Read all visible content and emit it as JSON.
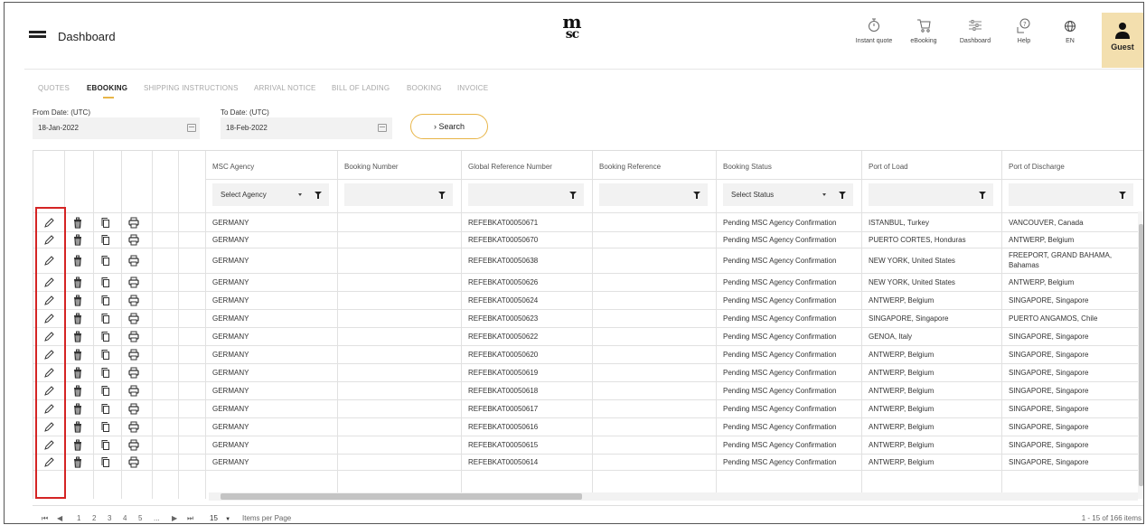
{
  "header": {
    "title": "Dashboard",
    "logo_top": "m",
    "logo_bottom": "sc",
    "nav": [
      {
        "label": "Instant quote",
        "icon": "stopwatch-icon"
      },
      {
        "label": "eBooking",
        "icon": "cart-icon"
      },
      {
        "label": "Dashboard",
        "icon": "sliders-icon"
      },
      {
        "label": "Help",
        "icon": "help-icon"
      },
      {
        "label": "EN",
        "icon": "globe-icon"
      }
    ],
    "guest_label": "Guest"
  },
  "tabs": [
    "QUOTES",
    "EBOOKING",
    "SHIPPING INSTRUCTIONS",
    "ARRIVAL NOTICE",
    "BILL OF LADING",
    "BOOKING",
    "INVOICE"
  ],
  "active_tab": "EBOOKING",
  "filters": {
    "from_label": "From Date: (UTC)",
    "from_value": "18-Jan-2022",
    "to_label": "To Date: (UTC)",
    "to_value": "18-Feb-2022",
    "search_label": "Search",
    "search_icon": "›"
  },
  "columns": [
    "MSC Agency",
    "Booking Number",
    "Global Reference Number",
    "Booking Reference",
    "Booking Status",
    "Port of Load",
    "Port of Discharge"
  ],
  "column_filters": {
    "agency_placeholder": "Select Agency",
    "status_placeholder": "Select Status"
  },
  "row_actions": [
    "edit-icon",
    "delete-icon",
    "copy-icon",
    "print-icon"
  ],
  "rows": [
    {
      "agency": "GERMANY",
      "booking_number": "",
      "global_ref": "REFEBKAT00050671",
      "booking_ref": "",
      "status": "Pending MSC Agency Confirmation",
      "pol": "ISTANBUL, Turkey",
      "pod": "VANCOUVER, Canada"
    },
    {
      "agency": "GERMANY",
      "booking_number": "",
      "global_ref": "REFEBKAT00050670",
      "booking_ref": "",
      "status": "Pending MSC Agency Confirmation",
      "pol": "PUERTO CORTES, Honduras",
      "pod": "ANTWERP, Belgium"
    },
    {
      "agency": "GERMANY",
      "booking_number": "",
      "global_ref": "REFEBKAT00050638",
      "booking_ref": "",
      "status": "Pending MSC Agency Confirmation",
      "pol": "NEW YORK, United States",
      "pod": "FREEPORT, GRAND BAHAMA, Bahamas"
    },
    {
      "agency": "GERMANY",
      "booking_number": "",
      "global_ref": "REFEBKAT00050626",
      "booking_ref": "",
      "status": "Pending MSC Agency Confirmation",
      "pol": "NEW YORK, United States",
      "pod": "ANTWERP, Belgium"
    },
    {
      "agency": "GERMANY",
      "booking_number": "",
      "global_ref": "REFEBKAT00050624",
      "booking_ref": "",
      "status": "Pending MSC Agency Confirmation",
      "pol": "ANTWERP, Belgium",
      "pod": "SINGAPORE, Singapore"
    },
    {
      "agency": "GERMANY",
      "booking_number": "",
      "global_ref": "REFEBKAT00050623",
      "booking_ref": "",
      "status": "Pending MSC Agency Confirmation",
      "pol": "SINGAPORE, Singapore",
      "pod": "PUERTO ANGAMOS, Chile"
    },
    {
      "agency": "GERMANY",
      "booking_number": "",
      "global_ref": "REFEBKAT00050622",
      "booking_ref": "",
      "status": "Pending MSC Agency Confirmation",
      "pol": "GENOA, Italy",
      "pod": "SINGAPORE, Singapore"
    },
    {
      "agency": "GERMANY",
      "booking_number": "",
      "global_ref": "REFEBKAT00050620",
      "booking_ref": "",
      "status": "Pending MSC Agency Confirmation",
      "pol": "ANTWERP, Belgium",
      "pod": "SINGAPORE, Singapore"
    },
    {
      "agency": "GERMANY",
      "booking_number": "",
      "global_ref": "REFEBKAT00050619",
      "booking_ref": "",
      "status": "Pending MSC Agency Confirmation",
      "pol": "ANTWERP, Belgium",
      "pod": "SINGAPORE, Singapore"
    },
    {
      "agency": "GERMANY",
      "booking_number": "",
      "global_ref": "REFEBKAT00050618",
      "booking_ref": "",
      "status": "Pending MSC Agency Confirmation",
      "pol": "ANTWERP, Belgium",
      "pod": "SINGAPORE, Singapore"
    },
    {
      "agency": "GERMANY",
      "booking_number": "",
      "global_ref": "REFEBKAT00050617",
      "booking_ref": "",
      "status": "Pending MSC Agency Confirmation",
      "pol": "ANTWERP, Belgium",
      "pod": "SINGAPORE, Singapore"
    },
    {
      "agency": "GERMANY",
      "booking_number": "",
      "global_ref": "REFEBKAT00050616",
      "booking_ref": "",
      "status": "Pending MSC Agency Confirmation",
      "pol": "ANTWERP, Belgium",
      "pod": "SINGAPORE, Singapore"
    },
    {
      "agency": "GERMANY",
      "booking_number": "",
      "global_ref": "REFEBKAT00050615",
      "booking_ref": "",
      "status": "Pending MSC Agency Confirmation",
      "pol": "ANTWERP, Belgium",
      "pod": "SINGAPORE, Singapore"
    },
    {
      "agency": "GERMANY",
      "booking_number": "",
      "global_ref": "REFEBKAT00050614",
      "booking_ref": "",
      "status": "Pending MSC Agency Confirmation",
      "pol": "ANTWERP, Belgium",
      "pod": "SINGAPORE, Singapore"
    }
  ],
  "pager": {
    "first": "⏮",
    "prev": "◀",
    "pages": [
      "1",
      "2",
      "3",
      "4",
      "5",
      "..."
    ],
    "next": "▶",
    "last": "⏭",
    "page_size": "15",
    "page_size_label": "Items per Page",
    "info": "1 - 15 of 166 items"
  },
  "colors": {
    "accent": "#e8b548",
    "guest_bg": "#f3dfae",
    "highlight": "#d42424"
  }
}
